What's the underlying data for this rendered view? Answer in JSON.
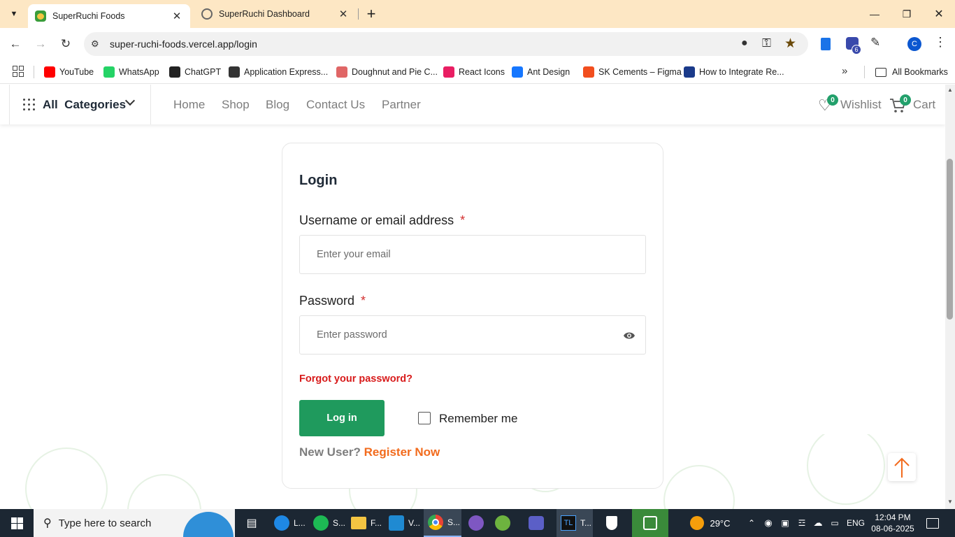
{
  "browser": {
    "tabs": [
      {
        "title": "SuperRuchi Foods",
        "active": true
      },
      {
        "title": "SuperRuchi Dashboard",
        "active": false
      }
    ],
    "url": "super-ruchi-foods.vercel.app/login",
    "profile_initial": "C",
    "extension_badge": "6",
    "bookmarks": [
      {
        "label": "YouTube",
        "icon": "youtube-icon",
        "color": "#ff0000"
      },
      {
        "label": "WhatsApp",
        "icon": "whatsapp-icon",
        "color": "#25d366"
      },
      {
        "label": "ChatGPT",
        "icon": "chatgpt-icon",
        "color": "#222222"
      },
      {
        "label": "Application Express...",
        "icon": "apex-icon",
        "color": "#333333"
      },
      {
        "label": "Doughnut and Pie C...",
        "icon": "chart-icon",
        "color": "#e06666"
      },
      {
        "label": "React Icons",
        "icon": "react-icon",
        "color": "#e91e63"
      },
      {
        "label": "Ant Design",
        "icon": "antd-icon",
        "color": "#1677ff"
      },
      {
        "label": "SK Cements – Figma",
        "icon": "figma-icon",
        "color": "#f24e1e"
      },
      {
        "label": "How to Integrate Re...",
        "icon": "article-icon",
        "color": "#1a3a8a"
      }
    ],
    "all_bookmarks": "All Bookmarks"
  },
  "site": {
    "categories_label": "All  Categories",
    "nav": [
      "Home",
      "Shop",
      "Blog",
      "Contact Us",
      "Partner"
    ],
    "wishlist_label": "Wishlist",
    "wishlist_count": "0",
    "cart_label": "Cart",
    "cart_count": "0",
    "accent": "#1f9a5d"
  },
  "login": {
    "title": "Login",
    "username_label": "Username or email address",
    "required_mark": "*",
    "username_placeholder": "Enter your email",
    "password_label": "Password",
    "password_placeholder": "Enter password",
    "forgot": "Forgot your password?",
    "login_button": "Log in",
    "remember_me": "Remember me",
    "new_user": "New User?",
    "register": "Register Now"
  },
  "taskbar": {
    "search_placeholder": "Type here to search",
    "apps": [
      {
        "label": "L...",
        "icon": "edge-icon"
      },
      {
        "label": "S...",
        "icon": "spotify-icon"
      },
      {
        "label": "F...",
        "icon": "file-explorer-icon"
      },
      {
        "label": "V...",
        "icon": "vscode-icon"
      },
      {
        "label": "S...",
        "icon": "chrome-icon"
      },
      {
        "label": "T...",
        "icon": "tl-icon"
      }
    ],
    "weather": "29°C",
    "language": "ENG",
    "time": "12:04 PM",
    "date": "08-06-2025"
  }
}
